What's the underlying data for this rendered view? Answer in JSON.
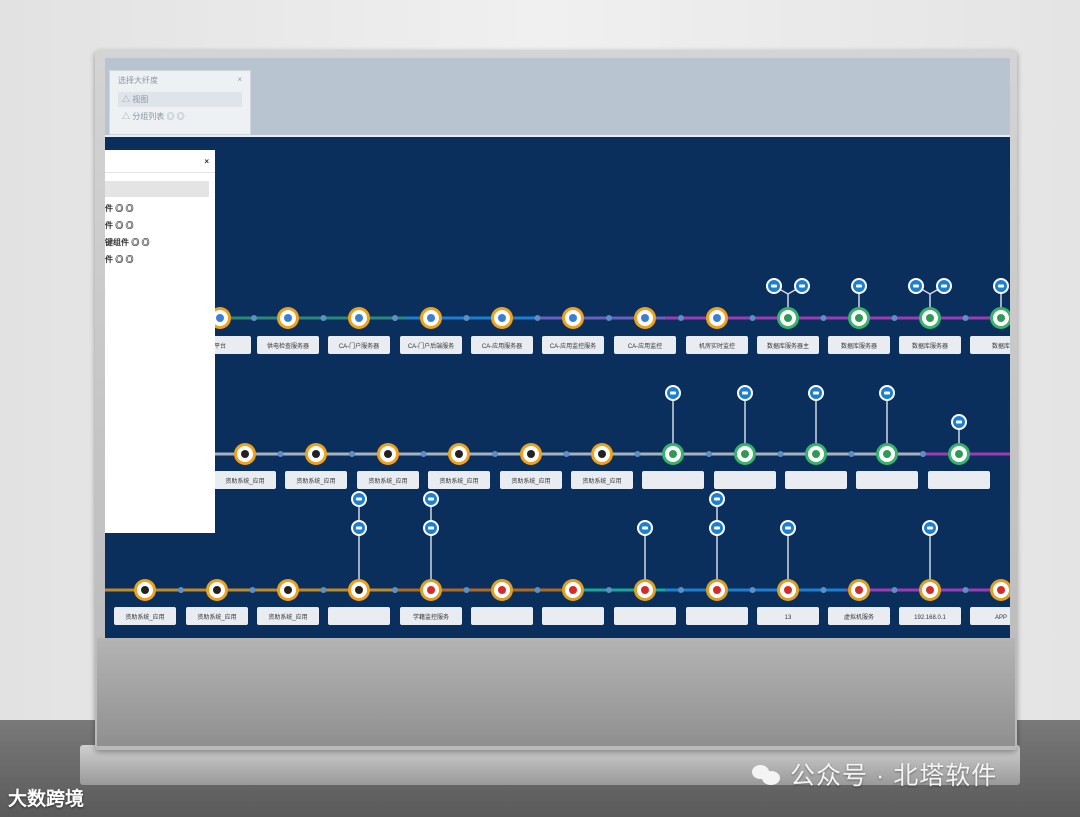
{
  "small_panel": {
    "title": "选择大纤度",
    "close": "×",
    "rows": [
      "△ 视图",
      "△ 分组列表 ◎ ◎"
    ]
  },
  "side_panel": {
    "close": "×",
    "items": [
      "件 ◎ ◎",
      "件 ◎ ◎",
      "键组件 ◎ ◎",
      "件 ◎ ◎"
    ]
  },
  "row1_labels": [
    "平台",
    "供电检查服务器",
    "CA-门户服务器",
    "CA-门户后端服务",
    "CA-应用服务器",
    "CA-应用监控服务",
    "CA-应用监控",
    "机房实时监控",
    "数据库服务器主",
    "数据库服务器",
    "数据库服务器",
    "数据库"
  ],
  "row2_labels": [
    "资助系统_应用",
    "资助系统_应用",
    "资助系统_应用",
    "资助系统_应用",
    "资助系统_应用",
    "资助系统_应用",
    "",
    "",
    "",
    "",
    "",
    ""
  ],
  "row3_labels": [
    "资助系统_应用",
    "资助系统_应用",
    "资助系统_应用",
    "",
    "学籍监控服务",
    "",
    "",
    "",
    "",
    "13",
    "虚拟机服务",
    "192.168.0.1",
    "APP"
  ],
  "watermark_brand": "公众号 · 北塔软件",
  "watermark_source": "大数跨境",
  "colors": {
    "screen_bg": "#0b2f5c",
    "node_orange": "#f0a21a",
    "node_green": "#37b36b",
    "node_blue": "#1e7fd0",
    "line_purple": "#9d3bb5",
    "line_teal": "#1aa79a"
  }
}
